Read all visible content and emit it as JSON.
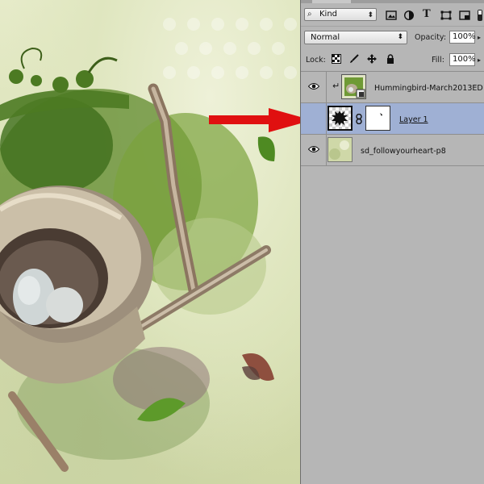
{
  "layers_panel": {
    "filter": {
      "value": "Kind",
      "icon": "search-icon"
    },
    "filter_icons": [
      "image-filter-icon",
      "adjustment-filter-icon",
      "type-filter-icon",
      "shape-filter-icon",
      "smart-object-filter-icon"
    ],
    "blend_mode": "Normal",
    "opacity_label": "Opacity:",
    "opacity_value": "100%",
    "lock_label": "Lock:",
    "lock_icons": [
      "lock-transparency-icon",
      "lock-image-icon",
      "lock-position-icon",
      "lock-all-icon"
    ],
    "fill_label": "Fill:",
    "fill_value": "100%",
    "layers": [
      {
        "name": "Hummingbird-March2013ED",
        "visible": true,
        "clipped": true,
        "selected": false,
        "smart_object": true
      },
      {
        "name": "Layer 1",
        "visible": false,
        "selected": true,
        "has_mask": true,
        "linked": true
      },
      {
        "name": "sd_followyourheart-p8",
        "visible": true,
        "selected": false
      }
    ]
  },
  "colors": {
    "selection": "#9fb0d4",
    "panel_bg": "#b6b6b6",
    "annotation_arrow": "#e01010"
  }
}
